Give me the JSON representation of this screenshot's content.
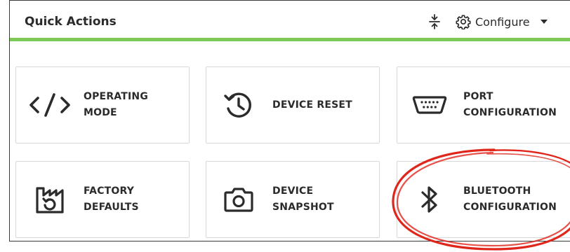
{
  "header": {
    "title": "Quick Actions",
    "configure_label": "Configure",
    "accent_color": "#7cc957"
  },
  "tiles": [
    {
      "label": "OPERATING\nMODE",
      "icon": "code-icon"
    },
    {
      "label": "DEVICE RESET",
      "icon": "history-icon"
    },
    {
      "label": "PORT\nCONFIGURATION",
      "icon": "serial-port-icon"
    },
    {
      "label": "FACTORY\nDEFAULTS",
      "icon": "factory-restore-icon"
    },
    {
      "label": "DEVICE\nSNAPSHOT",
      "icon": "camera-icon"
    },
    {
      "label": "BLUETOOTH\nCONFIGURATION",
      "icon": "bluetooth-icon"
    }
  ],
  "annotation": {
    "highlight_color": "#e0261b",
    "target": "BLUETOOTH CONFIGURATION"
  }
}
